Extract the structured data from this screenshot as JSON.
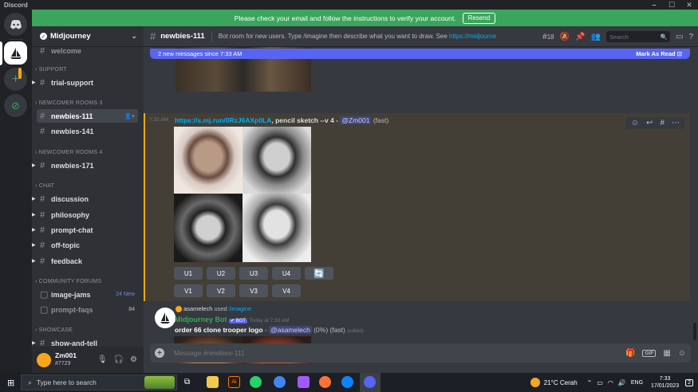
{
  "window": {
    "title": "Discord"
  },
  "banner": {
    "text": "Please check your email and follow the instructions to verify your account.",
    "resend": "Resend"
  },
  "server": {
    "name": "Midjourney"
  },
  "sidebar": {
    "welcome": "welcome",
    "categories": [
      "SUPPORT",
      "NEWCOMER ROOMS 3",
      "NEWCOMER ROOMS 4",
      "CHAT",
      "COMMUNITY FORUMS",
      "SHOWCASE"
    ],
    "channels": {
      "trial_support": "trial-support",
      "newbies_111": "newbies-111",
      "newbies_141": "newbies-141",
      "newbies_171": "newbies-171",
      "discussion": "discussion",
      "philosophy": "philosophy",
      "prompt_chat": "prompt-chat",
      "off_topic": "off-topic",
      "feedback": "feedback",
      "image_jams": "image-jams",
      "prompt_faqs": "prompt-faqs",
      "show_and_tell": "show-and-tell"
    },
    "badges": {
      "image_jams": "24 New",
      "prompt_faqs": "84"
    }
  },
  "user": {
    "name": "Zm001",
    "tag": "#7729"
  },
  "header": {
    "channel": "newbies-111",
    "topic": "Bot room for new users. Type /imagine then describe what you want to draw. See ",
    "topic_link": "https://midjourney.git...",
    "threads_count": "18",
    "search_placeholder": "Search"
  },
  "new_messages": {
    "text": "2 new messages since 7:33 AM",
    "action": "Mark As Read"
  },
  "message1": {
    "time": "7:33 AM",
    "link": "https://s.mj.run/0RzJ6AXp0LA",
    "prompt": ", pencil sketch --v 4 - ",
    "mention": "@Zm001",
    "mode": "(fast)",
    "upscale_buttons": [
      "U1",
      "U2",
      "U3",
      "U4"
    ],
    "variation_buttons": [
      "V1",
      "V2",
      "V3",
      "V4"
    ],
    "reroll": "🔄"
  },
  "message2": {
    "reply_user": "asamelech",
    "reply_used": "used",
    "reply_cmd": "/imagine",
    "author": "Midjourney Bot",
    "bot_badge": "✔ BOT",
    "time": "Today at 7:33 AM",
    "prompt": "order 66 clone trooper logo",
    "sep": " - ",
    "mention": "@asamelech",
    "status": "(0%) (fast)",
    "edited": "(edited)"
  },
  "composer": {
    "placeholder": "Message #newbies-111"
  },
  "taskbar": {
    "search": "Type here to search",
    "weather": "21°C  Cerah",
    "lang": "ENG",
    "time": "7:33",
    "date": "17/01/2023",
    "notif": "2"
  },
  "colors": {
    "accent": "#5865f2",
    "banner": "#3ba55d",
    "highlight": "#faa61a",
    "link": "#00aff4"
  }
}
